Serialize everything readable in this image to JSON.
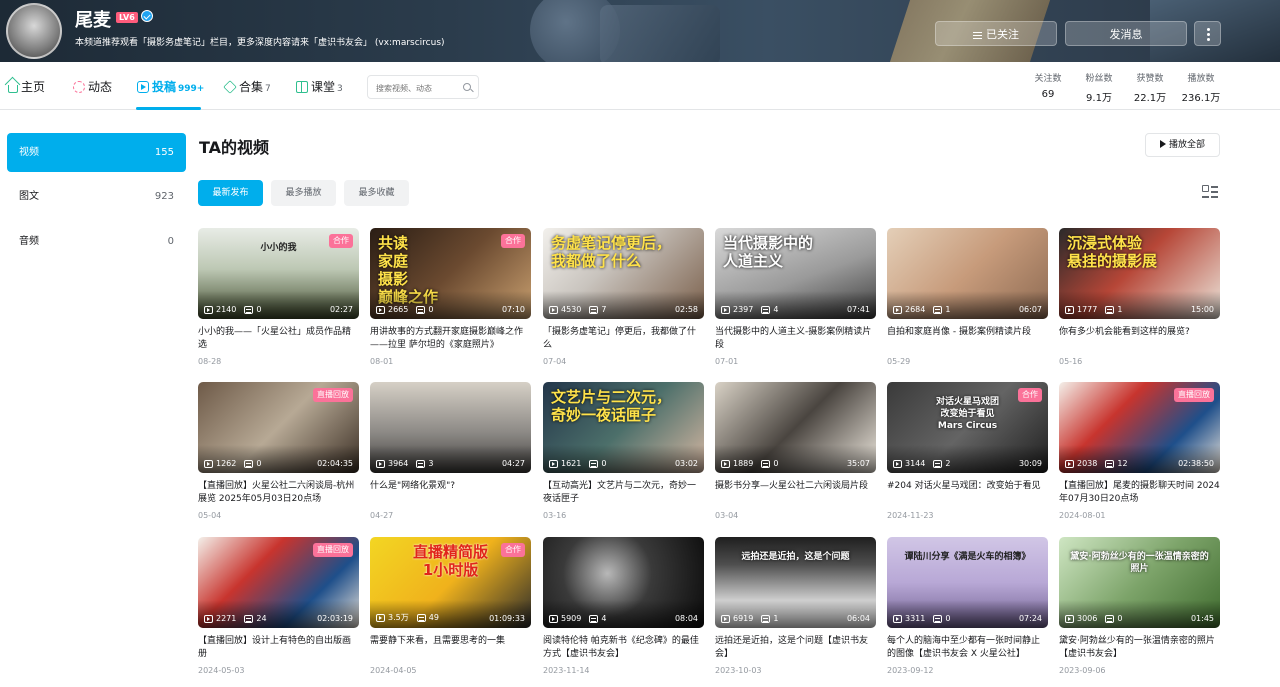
{
  "header": {
    "username": "尾麦",
    "level": "LV6",
    "sign": "本频道推荐观看「摄影务虚笔记」栏目，更多深度内容请来「虚识书友会」 (vx:marscircus)",
    "follow_label": "已关注",
    "message_label": "发消息"
  },
  "nav": {
    "home": "主页",
    "dynamic": "动态",
    "upload": "投稿",
    "upload_count": "999+",
    "collection": "合集",
    "collection_count": "7",
    "course": "课堂",
    "course_count": "3",
    "search_placeholder": "搜索视频、动态"
  },
  "stats": [
    {
      "label": "关注数",
      "value": "69"
    },
    {
      "label": "粉丝数",
      "value": "9.1万"
    },
    {
      "label": "获赞数",
      "value": "22.1万"
    },
    {
      "label": "播放数",
      "value": "236.1万"
    }
  ],
  "sidebar": [
    {
      "label": "视频",
      "count": "155"
    },
    {
      "label": "图文",
      "count": "923"
    },
    {
      "label": "音频",
      "count": "0"
    }
  ],
  "main": {
    "title": "TA的视频",
    "play_all": "播放全部",
    "sort": [
      "最新发布",
      "最多播放",
      "最多收藏"
    ]
  },
  "videos": [
    {
      "thumb_text": "小小的我",
      "badge": "合作",
      "views": "2140",
      "danmaku": "0",
      "duration": "02:27",
      "title": "小小的我——「火星公社」成员作品精选",
      "date": "08-28"
    },
    {
      "thumb_text": "共读\n家庭\n摄影\n巅峰之作",
      "badge": "合作",
      "views": "2665",
      "danmaku": "0",
      "duration": "07:10",
      "title": "用讲故事的方式翻开家庭摄影巅峰之作——拉里 萨尔坦的《家庭照片》",
      "date": "08-01"
    },
    {
      "thumb_text": "务虚笔记停更后，\n我都做了什么",
      "badge": "",
      "views": "4530",
      "danmaku": "7",
      "duration": "02:58",
      "title": "「摄影务虚笔记」停更后，我都做了什么",
      "date": "07-04"
    },
    {
      "thumb_text": "当代摄影中的\n人道主义",
      "badge": "",
      "views": "2397",
      "danmaku": "4",
      "duration": "07:41",
      "title": "当代摄影中的人道主义-摄影案例精读片段",
      "date": "07-01"
    },
    {
      "thumb_text": "",
      "badge": "",
      "views": "2684",
      "danmaku": "1",
      "duration": "06:07",
      "title": "自拍和家庭肖像 - 摄影案例精读片段",
      "date": "05-29"
    },
    {
      "thumb_text": "沉浸式体验\n悬挂的摄影展",
      "badge": "",
      "views": "1777",
      "danmaku": "1",
      "duration": "15:00",
      "title": "你有多少机会能看到这样的展览?",
      "date": "05-16"
    },
    {
      "thumb_text": "",
      "badge": "直播回放",
      "views": "1262",
      "danmaku": "0",
      "duration": "02:04:35",
      "title": "【直播回放】火星公社二六闲谈局-杭州展览 2025年05月03日20点场",
      "date": "05-04"
    },
    {
      "thumb_text": "",
      "badge": "",
      "views": "3964",
      "danmaku": "3",
      "duration": "04:27",
      "title": "什么是\"网络化景观\"?",
      "date": "04-27"
    },
    {
      "thumb_text": "文艺片与二次元，\n奇妙一夜话匣子",
      "badge": "",
      "views": "1621",
      "danmaku": "0",
      "duration": "03:02",
      "title": "【互动高光】文艺片与二次元，奇妙一夜话匣子",
      "date": "03-16"
    },
    {
      "thumb_text": "",
      "badge": "",
      "views": "1889",
      "danmaku": "0",
      "duration": "35:07",
      "title": "摄影书分享—火星公社二六闲谈局片段",
      "date": "03-04"
    },
    {
      "thumb_text": "对话火星马戏团\n改变始于看见\nMars Circus",
      "badge": "合作",
      "views": "3144",
      "danmaku": "2",
      "duration": "30:09",
      "title": "#204 对话火星马戏团：改变始于看见",
      "date": "2024-11-23"
    },
    {
      "thumb_text": "",
      "badge": "直播回放",
      "views": "2038",
      "danmaku": "12",
      "duration": "02:38:50",
      "title": "【直播回放】尾麦的摄影聊天时间 2024年07月30日20点场",
      "date": "2024-08-01"
    },
    {
      "thumb_text": "",
      "badge": "直播回放",
      "views": "2271",
      "danmaku": "24",
      "duration": "02:03:19",
      "title": "【直播回放】设计上有特色的自出版画册",
      "date": "2024-05-03"
    },
    {
      "thumb_text": "直播精简版\n1小时版",
      "badge": "合作",
      "views": "3.5万",
      "danmaku": "49",
      "duration": "01:09:33",
      "title": "需要静下来看，且需要思考的一集",
      "date": "2024-04-05"
    },
    {
      "thumb_text": "",
      "badge": "",
      "views": "5909",
      "danmaku": "4",
      "duration": "08:04",
      "title": "阅读特伦特 帕克新书《纪念碑》的最佳方式【虚识书友会】",
      "date": "2023-11-14"
    },
    {
      "thumb_text": "远拍还是近拍，这是个问题",
      "badge": "",
      "views": "6919",
      "danmaku": "1",
      "duration": "06:04",
      "title": "远拍还是近拍，这是个问题【虚识书友会】",
      "date": "2023-10-03"
    },
    {
      "thumb_text": "谭陆川分享《满是火车的相簿》",
      "badge": "",
      "views": "3311",
      "danmaku": "0",
      "duration": "07:24",
      "title": "每个人的脑海中至少都有一张时间静止的图像【虚识书友会 X 火星公社】",
      "date": "2023-09-12"
    },
    {
      "thumb_text": "黛安·阿勃丝少有的一张温情亲密的照片",
      "badge": "",
      "views": "3006",
      "danmaku": "0",
      "duration": "01:45",
      "title": "黛安·阿勃丝少有的一张温情亲密的照片【虚识书友会】",
      "date": "2023-09-06"
    }
  ]
}
